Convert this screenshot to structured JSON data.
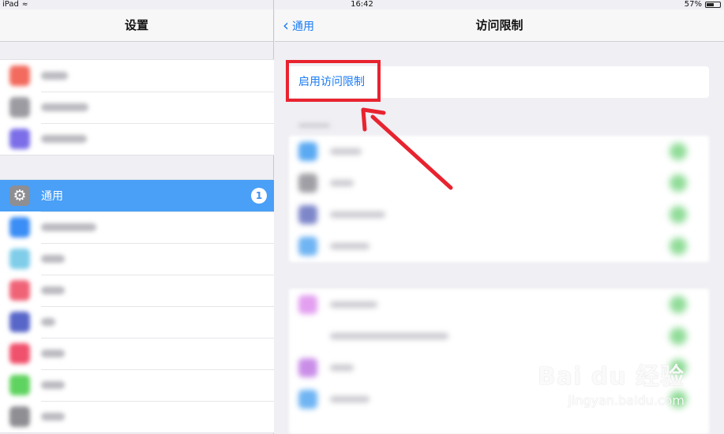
{
  "status_bar": {
    "device": "iPad",
    "time": "16:42",
    "battery": "57%",
    "battery_level": 0.57
  },
  "master": {
    "title": "设置",
    "selected_item": {
      "label": "通用",
      "badge": "1",
      "icon": "gear-icon"
    }
  },
  "detail": {
    "back_label": "通用",
    "title": "访问限制",
    "enable_restrictions_label": "启用访问限制"
  },
  "colors": {
    "accent": "#1a7cf5",
    "selected_row": "#4a9ff7",
    "annotation": "#e8232f"
  },
  "watermark": {
    "brand": "Bai du 经验",
    "url": "jingyan.baidu.com"
  }
}
